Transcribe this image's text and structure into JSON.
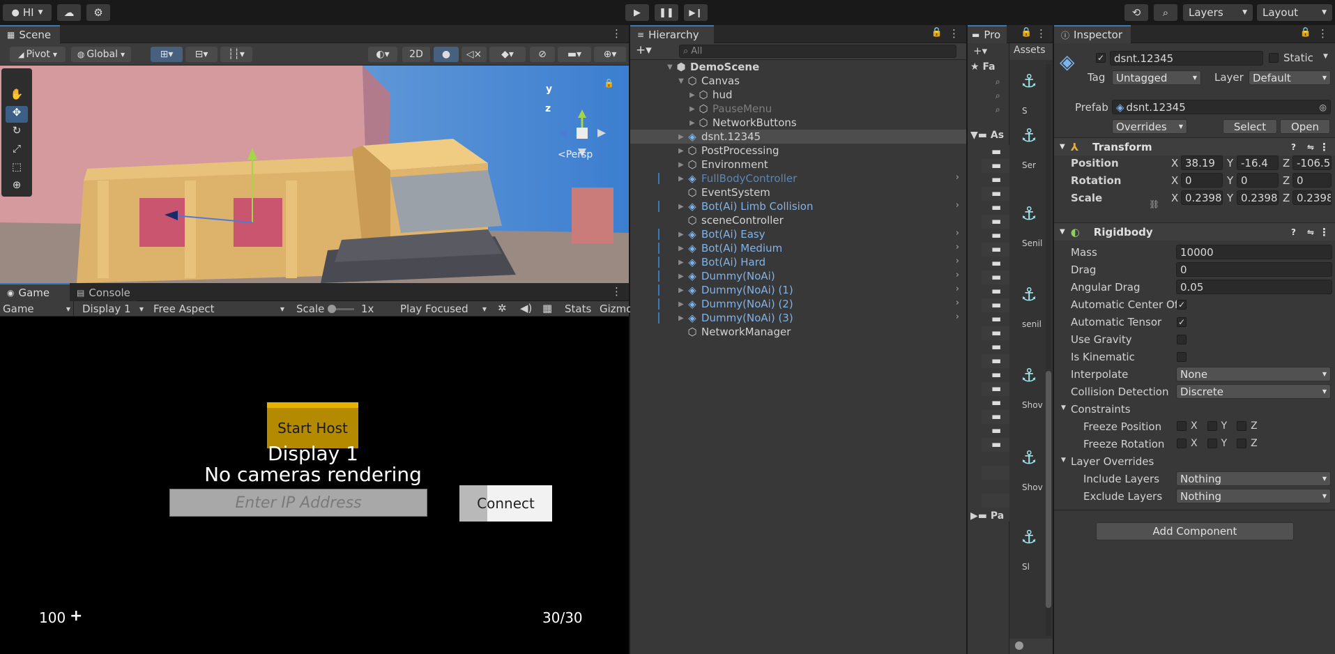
{
  "topbar": {
    "account": "HI",
    "play_icon": "play-icon",
    "layers": "Layers",
    "layout": "Layout"
  },
  "scene": {
    "tab": "Scene",
    "pivot": "Pivot",
    "global": "Global",
    "mode2d": "2D",
    "persp": "<Persp",
    "axes": {
      "y": "y",
      "z": "z"
    }
  },
  "game": {
    "tab": "Game",
    "console_tab": "Console",
    "view": "Game",
    "display": "Display 1",
    "aspect": "Free Aspect",
    "scale_label": "Scale",
    "scale_value": "1x",
    "play_mode": "Play Focused",
    "stats": "Stats",
    "gizmos": "Gizmo",
    "start_host": "Start Host",
    "display_msg": "Display 1",
    "no_cameras": "No cameras rendering",
    "ip_placeholder": "Enter IP Address",
    "connect": "Connect",
    "health": "100",
    "plus": "+",
    "ammo": "30/30"
  },
  "hierarchy": {
    "tab": "Hierarchy",
    "search_placeholder": "All",
    "items": [
      {
        "label": "DemoScene",
        "depth": 0,
        "expand": "▼",
        "icon": "unity-scene-icon",
        "style": "bold"
      },
      {
        "label": "Canvas",
        "depth": 1,
        "expand": "▼",
        "icon": "gameobject-icon",
        "style": ""
      },
      {
        "label": "hud",
        "depth": 2,
        "expand": "▶",
        "icon": "gameobject-icon",
        "style": ""
      },
      {
        "label": "PauseMenu",
        "depth": 2,
        "expand": "▶",
        "icon": "gameobject-icon",
        "style": "dimmed"
      },
      {
        "label": "NetworkButtons",
        "depth": 2,
        "expand": "▶",
        "icon": "gameobject-icon",
        "style": ""
      },
      {
        "label": "dsnt.12345",
        "depth": 1,
        "expand": "▶",
        "icon": "prefab-icon",
        "style": "selected"
      },
      {
        "label": "PostProcessing",
        "depth": 1,
        "expand": "▶",
        "icon": "gameobject-icon",
        "style": ""
      },
      {
        "label": "Environment",
        "depth": 1,
        "expand": "▶",
        "icon": "gameobject-icon",
        "style": ""
      },
      {
        "label": "FullBodyController",
        "depth": 1,
        "expand": "▶",
        "icon": "prefab-icon",
        "style": "bluedim"
      },
      {
        "label": "EventSystem",
        "depth": 1,
        "expand": "",
        "icon": "gameobject-icon",
        "style": ""
      },
      {
        "label": "Bot(Ai) Limb Collision",
        "depth": 1,
        "expand": "▶",
        "icon": "prefab-icon",
        "style": "blue"
      },
      {
        "label": "sceneController",
        "depth": 1,
        "expand": "",
        "icon": "gameobject-icon",
        "style": ""
      },
      {
        "label": "Bot(Ai) Easy",
        "depth": 1,
        "expand": "▶",
        "icon": "prefab-icon",
        "style": "blue"
      },
      {
        "label": "Bot(Ai) Medium",
        "depth": 1,
        "expand": "▶",
        "icon": "prefab-icon",
        "style": "blue"
      },
      {
        "label": "Bot(Ai) Hard",
        "depth": 1,
        "expand": "▶",
        "icon": "prefab-icon",
        "style": "blue"
      },
      {
        "label": "Dummy(NoAi)",
        "depth": 1,
        "expand": "▶",
        "icon": "prefab-icon",
        "style": "blue"
      },
      {
        "label": "Dummy(NoAi) (1)",
        "depth": 1,
        "expand": "▶",
        "icon": "prefab-icon",
        "style": "blue"
      },
      {
        "label": "Dummy(NoAi) (2)",
        "depth": 1,
        "expand": "▶",
        "icon": "prefab-icon",
        "style": "blue"
      },
      {
        "label": "Dummy(NoAi) (3)",
        "depth": 1,
        "expand": "▶",
        "icon": "prefab-icon",
        "style": "blue"
      },
      {
        "label": "NetworkManager",
        "depth": 1,
        "expand": "",
        "icon": "gameobject-icon",
        "style": ""
      }
    ]
  },
  "project": {
    "tab": "Pro",
    "fav": "Fa",
    "assets_root": "As",
    "assets_tab": "Assets",
    "packages": "Pa",
    "thumbs": [
      "S",
      "Ser",
      "Senil",
      "senil",
      "Shov",
      "Shov",
      "Sl"
    ]
  },
  "inspector": {
    "tab": "Inspector",
    "object_name": "dsnt.12345",
    "static": "Static",
    "tag_label": "Tag",
    "tag": "Untagged",
    "layer_label": "Layer",
    "layer": "Default",
    "prefab_label": "Prefab",
    "prefab": "dsnt.12345",
    "overrides": "Overrides",
    "select": "Select",
    "open": "Open",
    "transform": {
      "title": "Transform",
      "position_label": "Position",
      "rotation_label": "Rotation",
      "scale_label": "Scale",
      "position": {
        "x": "38.19",
        "y": "-16.4",
        "z": "-106.5"
      },
      "rotation": {
        "x": "0",
        "y": "0",
        "z": "0"
      },
      "scale": {
        "x": "0.2398",
        "y": "0.2398",
        "z": "0.2398"
      }
    },
    "rigidbody": {
      "title": "Rigidbody",
      "mass_label": "Mass",
      "mass": "10000",
      "drag_label": "Drag",
      "drag": "0",
      "angular_label": "Angular Drag",
      "angular": "0.05",
      "auto_center_label": "Automatic Center Of",
      "auto_tensor_label": "Automatic Tensor",
      "gravity_label": "Use Gravity",
      "kinematic_label": "Is Kinematic",
      "interpolate_label": "Interpolate",
      "interpolate": "None",
      "collision_label": "Collision Detection",
      "collision": "Discrete",
      "constraints": "Constraints",
      "freeze_pos": "Freeze Position",
      "freeze_rot": "Freeze Rotation",
      "layer_overrides": "Layer Overrides",
      "include_label": "Include Layers",
      "include": "Nothing",
      "exclude_label": "Exclude Layers",
      "exclude": "Nothing"
    },
    "add_component": "Add Component"
  },
  "axis": {
    "x": "X",
    "y": "Y",
    "z": "Z"
  }
}
